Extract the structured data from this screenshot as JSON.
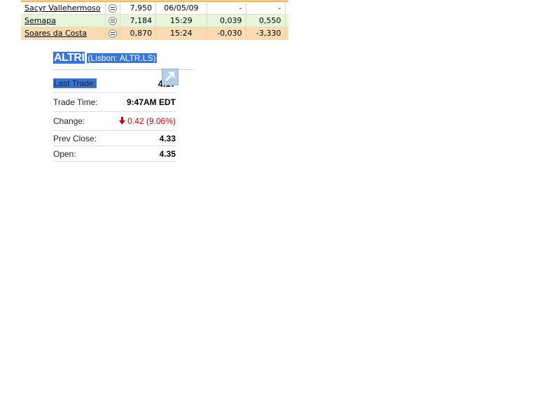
{
  "stock_table": {
    "rows": [
      {
        "name": "Sacyr Vallehermoso",
        "price": "7,950",
        "time": "06/05/09",
        "change": "-",
        "change_pct": "-",
        "style": "white"
      },
      {
        "name": "Semapa",
        "price": "7,184",
        "time": "15:29",
        "change": "0,039",
        "change_pct": "0,550",
        "style": "green"
      },
      {
        "name": "Soares da Costa",
        "price": "0,870",
        "time": "15:24",
        "change": "-0,030",
        "change_pct": "-3,330",
        "style": "orange"
      }
    ],
    "indicator_icon": "equals-circle-icon"
  },
  "quote": {
    "symbol": "ALTRI",
    "exchange": "(Lisbon: ALTR.LS)",
    "expand_icon": "expand-arrow-icon",
    "fields": {
      "last_trade_label": "Last Trade:",
      "last_trade_value": "4.17",
      "trade_time_label": "Trade Time:",
      "trade_time_value": "9:47AM EDT",
      "change_label": "Change:",
      "change_value": "0.42 (9.06%)",
      "change_direction": "down",
      "prev_close_label": "Prev Close:",
      "prev_close_value": "4.33",
      "open_label": "Open:",
      "open_value": "4.35"
    },
    "colors": {
      "selection": "#3875d7",
      "negative": "#cc0000",
      "row_green": "#e6f6dc",
      "row_orange": "#fbdcb2"
    }
  }
}
